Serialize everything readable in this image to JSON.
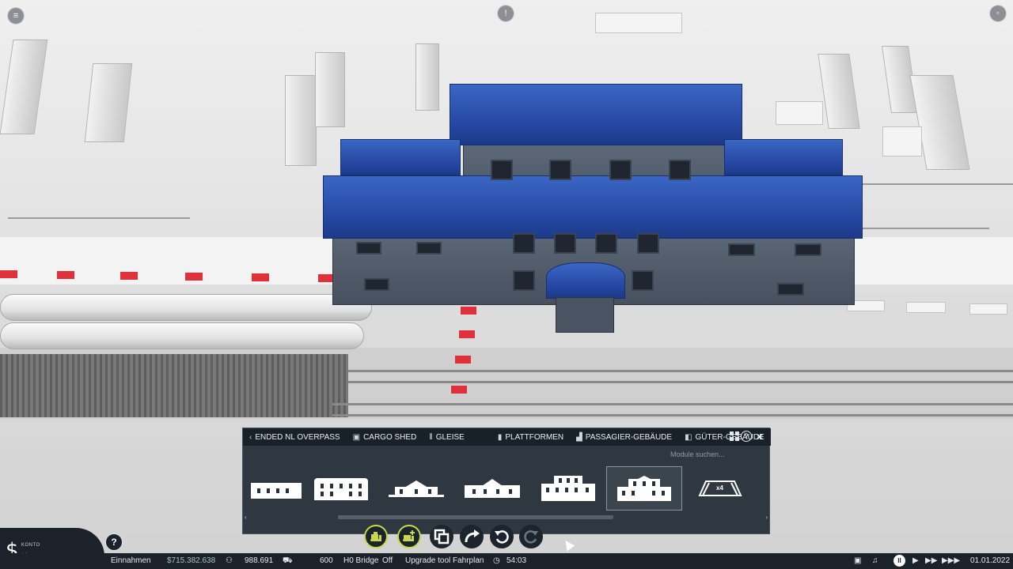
{
  "tabs": [
    {
      "label": "ENDED NL OVERPASS",
      "icon": "chevron-left-icon"
    },
    {
      "label": "CARGO SHED",
      "icon": "box-icon"
    },
    {
      "label": "GLEISE",
      "icon": "tracks-icon"
    },
    {
      "label": "PLATTFORMEN",
      "icon": "platform-icon"
    },
    {
      "label": "PASSAGIER-GEBÄUDE",
      "icon": "passenger-icon"
    },
    {
      "label": "GÜTER-GEBÄUDE",
      "icon": "cargo-icon"
    }
  ],
  "search": {
    "placeholder": "Module suchen..."
  },
  "modules": [
    {
      "name": "small-station-module",
      "selected": false
    },
    {
      "name": "medium-station-module",
      "selected": false
    },
    {
      "name": "roofed-station-module",
      "selected": false
    },
    {
      "name": "roofed-station-module-2",
      "selected": false
    },
    {
      "name": "large-station-module",
      "selected": false
    },
    {
      "name": "large-roofed-station-module",
      "selected": true
    },
    {
      "name": "platform-x4-module",
      "selected": false,
      "label": "x4"
    }
  ],
  "tools": [
    {
      "name": "bulldoze-tool",
      "icon": "bulldozer-icon",
      "active": true
    },
    {
      "name": "bulldoze-add-tool",
      "icon": "bulldozer-plus-icon",
      "active": true
    },
    {
      "name": "copy-tool",
      "icon": "copy-icon",
      "active": false
    },
    {
      "name": "move-tool",
      "icon": "curved-arrow-icon",
      "active": false
    },
    {
      "name": "undo-tool",
      "icon": "undo-icon",
      "active": false
    },
    {
      "name": "redo-tool",
      "icon": "redo-icon",
      "active": false
    }
  ],
  "status": {
    "konto_label": "KONTO",
    "konto_value": "∞",
    "help": "?",
    "einnahmen_label": "Einnahmen",
    "money": "$715.382.638",
    "population": "988.691",
    "vehicles": "600",
    "h0_bridge_label": "H0 Bridge",
    "h0_bridge_state": "Off",
    "upgrade_tool": "Upgrade tool",
    "fahrplan": "Fahrplan",
    "time": "54:03",
    "date": "01.01.2022"
  },
  "colors": {
    "roof_blue": "#2a52b8",
    "panel_bg": "#222c36",
    "statusbar_bg": "#1b2229",
    "bulldoze_accent": "#c9d84a",
    "planning_red": "#e0303a"
  }
}
